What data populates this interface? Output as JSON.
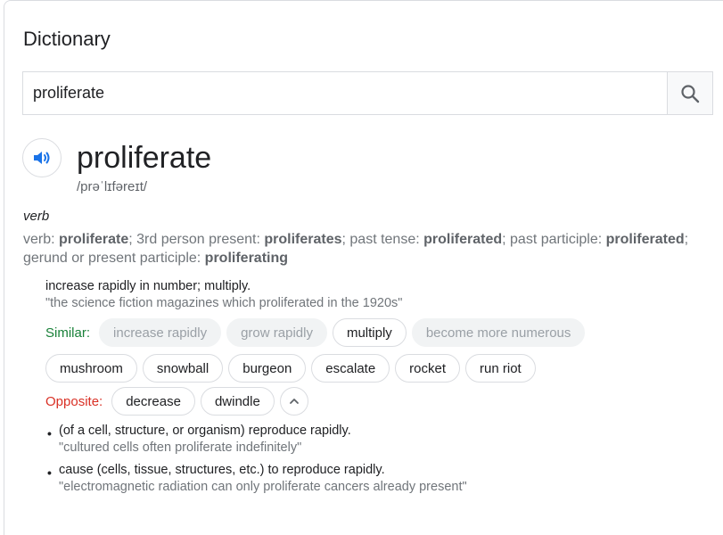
{
  "header": {
    "title": "Dictionary"
  },
  "search": {
    "value": "proliferate"
  },
  "entry": {
    "word": "proliferate",
    "phonetic": "/prəˈlɪfəreɪt/",
    "part_of_speech": "verb",
    "forms": {
      "verb_label": "verb: ",
      "verb": "proliferate",
      "third_label": "; 3rd person present: ",
      "third": "proliferates",
      "past_label": "; past tense: ",
      "past": "proliferated",
      "participle_label": "; past participle: ",
      "participle": "proliferated",
      "gerund_label": "; gerund or present participle: ",
      "gerund": "proliferating"
    }
  },
  "sense1": {
    "definition": "increase rapidly in number; multiply.",
    "example": "\"the science fiction magazines which proliferated in the 1920s\"",
    "similar_label": "Similar:",
    "similar_row1": [
      "increase rapidly",
      "grow rapidly",
      "multiply",
      "become more numerous"
    ],
    "similar_row2": [
      "mushroom",
      "snowball",
      "burgeon",
      "escalate",
      "rocket",
      "run riot"
    ],
    "opposite_label": "Opposite:",
    "opposites": [
      "decrease",
      "dwindle"
    ]
  },
  "sense2": {
    "definition": "(of a cell, structure, or organism) reproduce rapidly.",
    "example": "\"cultured cells often proliferate indefinitely\""
  },
  "sense3": {
    "definition": "cause (cells, tissue, structures, etc.) to reproduce rapidly.",
    "example": "\"electromagnetic radiation can only proliferate cancers already present\""
  },
  "colors": {
    "similar": "#188038",
    "opposite": "#d93025",
    "speaker": "#1a73e8"
  },
  "icons": {
    "search": "search-icon",
    "speaker": "speaker-icon",
    "collapse": "chevron-up-icon"
  }
}
